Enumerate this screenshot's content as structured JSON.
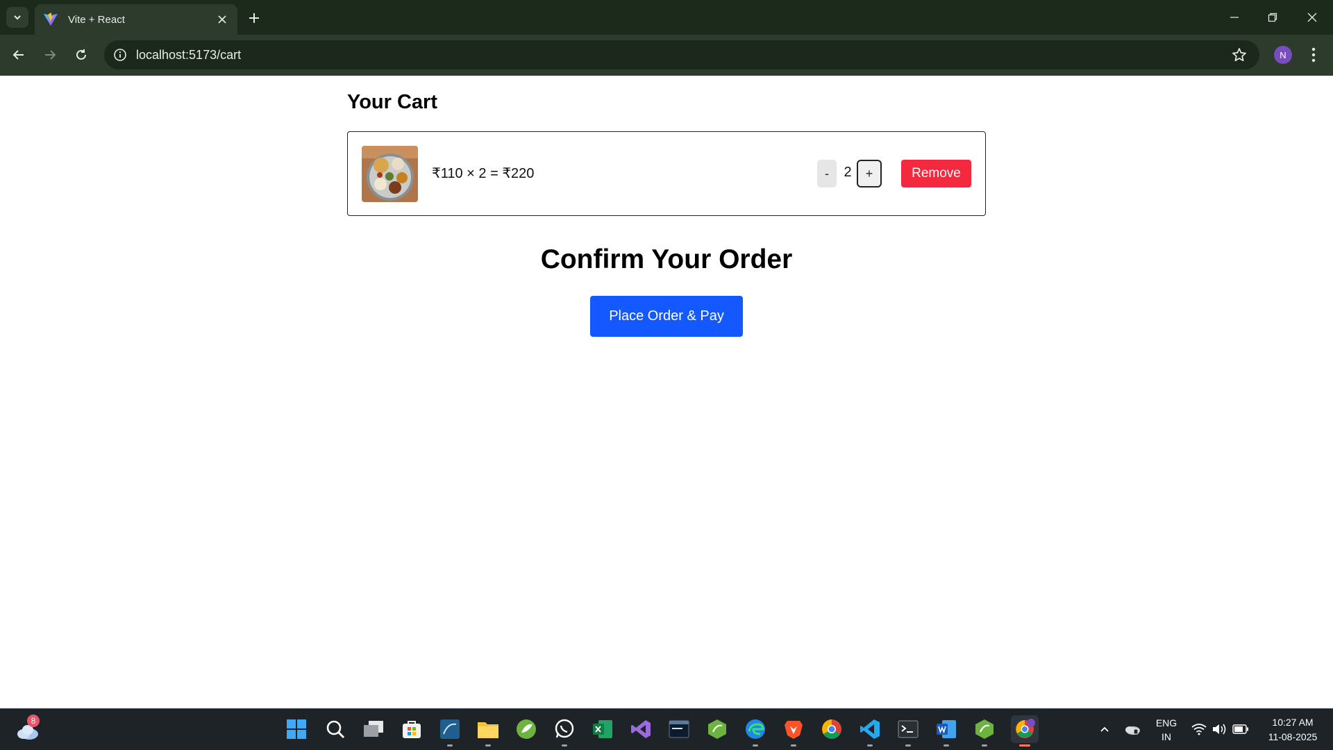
{
  "browser": {
    "tab_title": "Vite + React",
    "url": "localhost:5173/cart",
    "profile_initial": "N"
  },
  "cart": {
    "title": "Your Cart",
    "item": {
      "image": "thali-food-image",
      "price_line": "₹110 × 2 = ₹220",
      "minus_label": "-",
      "quantity": "2",
      "plus_label": "+",
      "remove_label": "Remove"
    }
  },
  "confirm": {
    "title": "Confirm Your Order",
    "button_label": "Place Order & Pay"
  },
  "colors": {
    "remove_button": "#f32a3f",
    "pay_button": "#1459ff",
    "chrome_bg": "#2c3b2c"
  },
  "taskbar": {
    "weather_badge": "8",
    "apps": [
      "start-icon",
      "search-icon",
      "task-view-icon",
      "store-icon",
      "mysql-workbench-icon",
      "file-explorer-icon",
      "spring-tool-icon",
      "whatsapp-icon",
      "excel-icon",
      "visual-studio-icon",
      "mysql-shell-icon",
      "spring-boot-icon",
      "edge-icon",
      "brave-icon",
      "chrome-icon",
      "vscode-icon",
      "terminal-icon",
      "word-icon",
      "spring-icon-2",
      "chrome-profile-icon"
    ],
    "language_line1": "ENG",
    "language_line2": "IN",
    "time": "10:27 AM",
    "date": "11-08-2025"
  }
}
